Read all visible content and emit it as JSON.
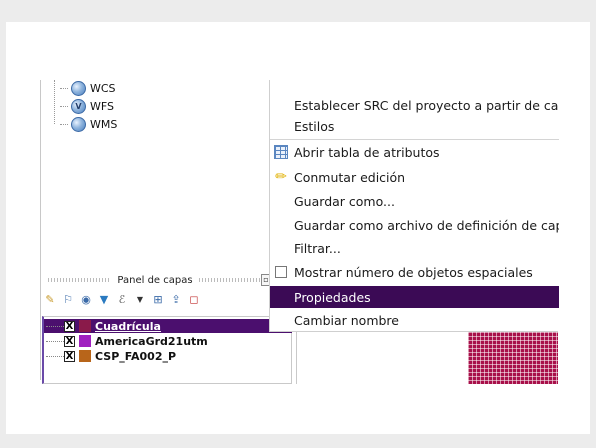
{
  "browser_tree": {
    "items": [
      {
        "label": "WCS",
        "icon": "wcs-globe-icon"
      },
      {
        "label": "WFS",
        "icon": "wfs-globe-icon",
        "badge": "V"
      },
      {
        "label": "WMS",
        "icon": "wms-globe-icon"
      }
    ]
  },
  "layers_panel": {
    "title": "Panel de capas",
    "layers": [
      {
        "name": "Cuadrícula",
        "checked": "X",
        "color": "#8a1a4a",
        "selected": true
      },
      {
        "name": "AmericaGrd21utm",
        "checked": "X",
        "color": "#a020c0",
        "selected": false
      },
      {
        "name": "CSP_FA002_P",
        "checked": "X",
        "color": "#b8651a",
        "selected": false
      }
    ]
  },
  "context_menu": {
    "items": [
      {
        "label": "Establecer SRC del proyecto a partir de capa"
      },
      {
        "label": "Estilos"
      },
      {
        "label": "Abrir tabla de atributos",
        "icon": "table-icon"
      },
      {
        "label": "Conmutar edición",
        "icon": "pencil-icon"
      },
      {
        "label": "Guardar como..."
      },
      {
        "label": "Guardar como archivo de definición de capa"
      },
      {
        "label": "Filtrar..."
      },
      {
        "label": "Mostrar número de objetos espaciales",
        "icon": "checkbox-icon"
      },
      {
        "label": "Propiedades",
        "highlighted": true
      },
      {
        "label": "Cambiar nombre"
      }
    ]
  },
  "colors": {
    "highlight": "#3b0a55",
    "selected_layer": "#4b0f6e",
    "grid_fill": "#a8104a"
  }
}
